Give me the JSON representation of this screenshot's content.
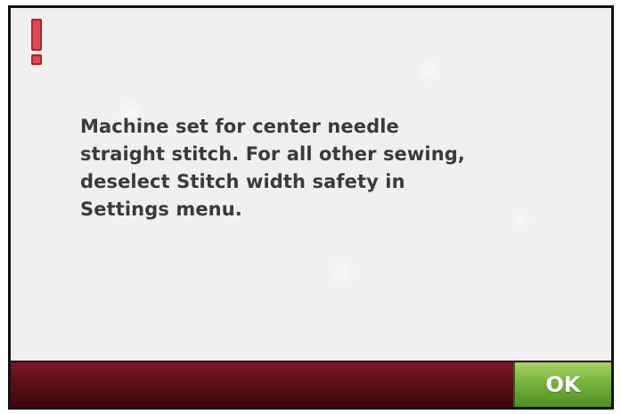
{
  "dialog": {
    "icon": "exclamation-alert-icon",
    "message_lines": [
      "Machine set for center needle",
      "straight stitch. For all other sewing,",
      "deselect Stitch width safety in",
      "Settings menu."
    ]
  },
  "actions": {
    "ok_label": "OK"
  },
  "colors": {
    "alert_red": "#c8323c",
    "bar_maroon": "#5e0d18",
    "ok_green": "#77b43a",
    "text_gray": "#3a3a3a"
  }
}
